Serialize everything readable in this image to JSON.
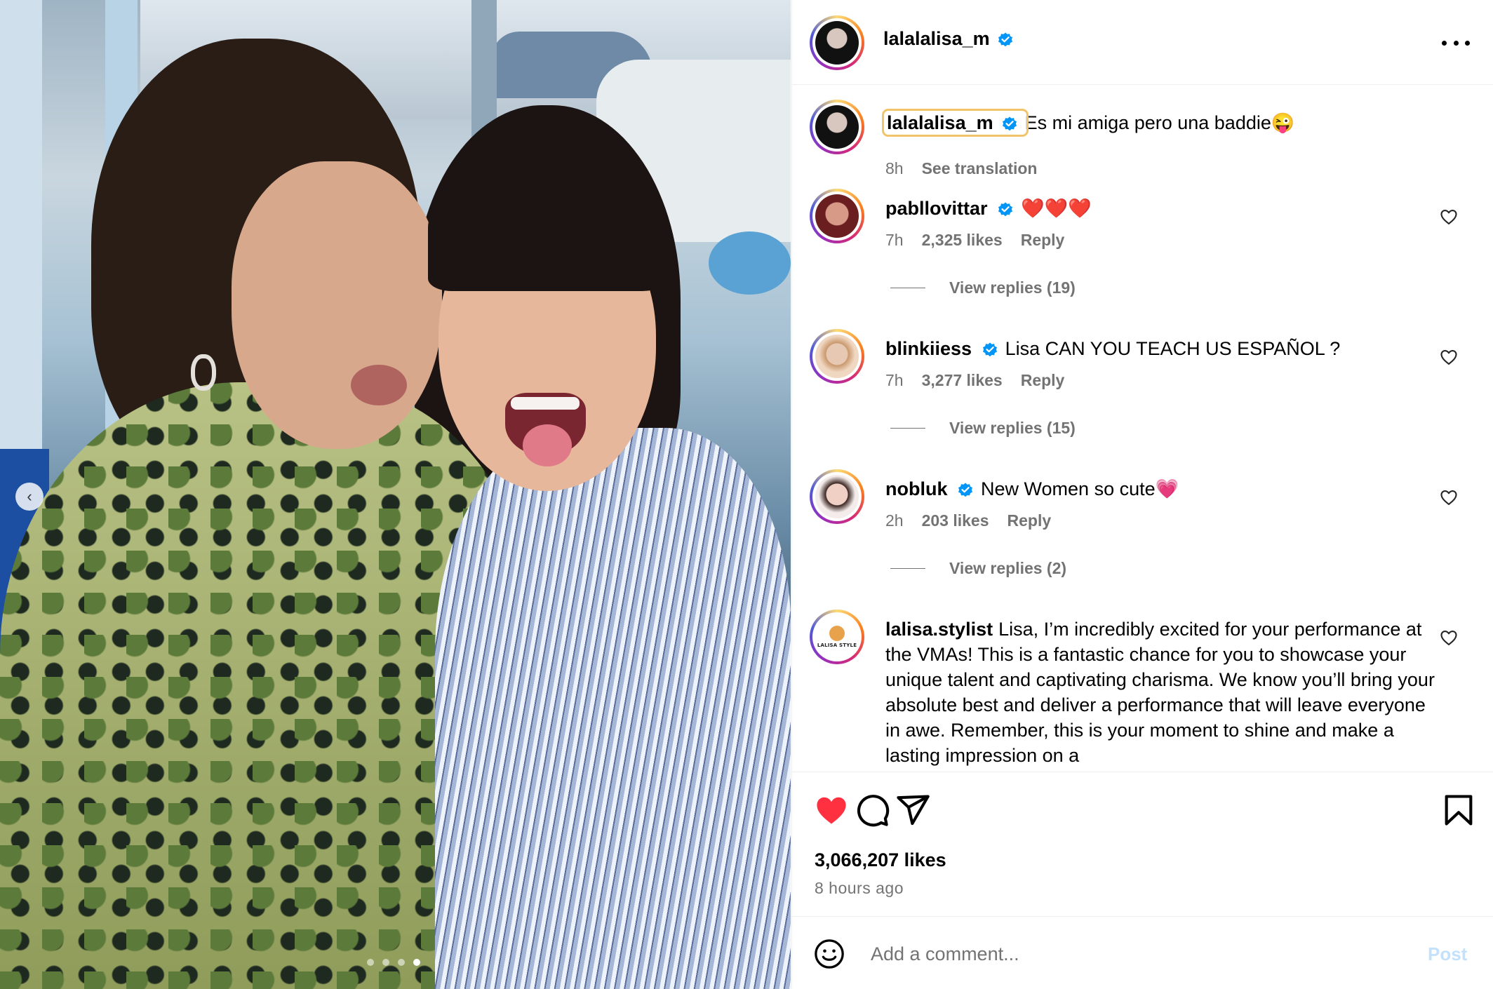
{
  "post": {
    "author": "lalalalisa_m",
    "carousel": {
      "slide_count": 4,
      "active_slide": 4,
      "prev_icon": "chevron-left-icon"
    },
    "caption": {
      "username": "lalalalisa_m",
      "text": "Es mi amiga pero una baddie😜",
      "time": "8h",
      "translate": "See translation"
    },
    "likes": "3,066,207 likes",
    "time_ago": "8 hours ago",
    "liked": true
  },
  "comments": [
    {
      "username": "pabllovittar",
      "verified": true,
      "text": "❤️❤️❤️",
      "time": "7h",
      "likes": "2,325 likes",
      "reply": "Reply",
      "view_replies": "View replies (19)"
    },
    {
      "username": "blinkiiess",
      "verified": true,
      "text": "Lisa CAN YOU TEACH US ESPAÑOL ?",
      "time": "7h",
      "likes": "3,277 likes",
      "reply": "Reply",
      "view_replies": "View replies (15)"
    },
    {
      "username": "nobluk",
      "verified": true,
      "text": "New Women so cute💗",
      "time": "2h",
      "likes": "203 likes",
      "reply": "Reply",
      "view_replies": "View replies (2)"
    },
    {
      "username": "lalisa.stylist",
      "verified": false,
      "avatar_text": "LALISA STYLE",
      "text": "Lisa, I’m incredibly excited for your performance at the VMAs! This is a fantastic chance for you to showcase your unique talent and captivating charisma. We know you’ll bring your absolute best and deliver a performance that will leave everyone in awe. Remember, this is your moment to shine and make a lasting impression on a"
    }
  ],
  "add_comment": {
    "placeholder": "Add a comment...",
    "post_label": "Post"
  },
  "colors": {
    "verified": "#0095f6",
    "like_red": "#ff3040",
    "muted": "#737373",
    "post_disabled": "#c4e1fb"
  },
  "icons": [
    "more-options-icon",
    "heart-icon",
    "comment-icon",
    "share-icon",
    "bookmark-icon",
    "emoji-icon",
    "verified-icon"
  ]
}
